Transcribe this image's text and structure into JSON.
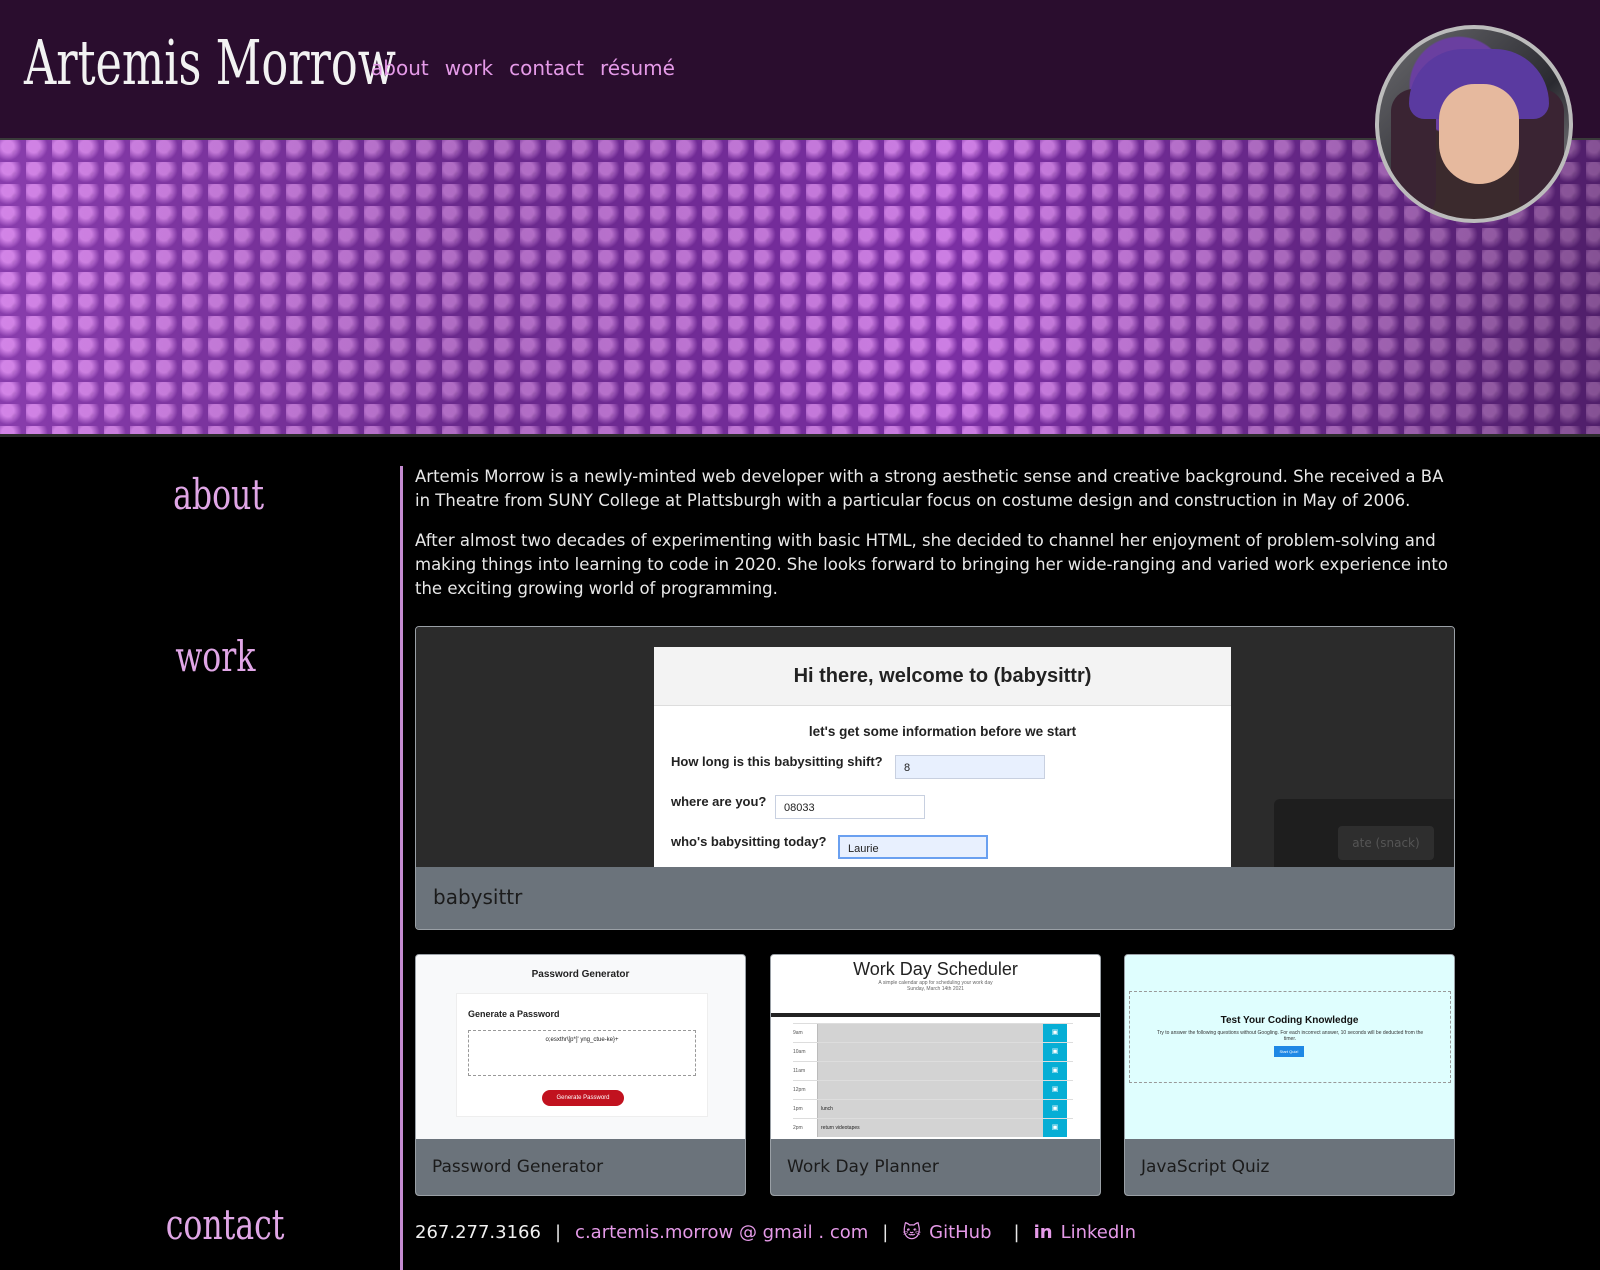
{
  "header": {
    "brand": "Artemis Morrow",
    "nav": [
      "about",
      "work",
      "contact",
      "résumé"
    ]
  },
  "sections": {
    "about_label": "about",
    "work_label": "work",
    "contact_label": "contact"
  },
  "about": {
    "p1": "Artemis Morrow is a newly-minted web developer with a strong aesthetic sense and creative background. She received a BA in Theatre from SUNY College at Plattsburgh with a particular focus on costume design and construction in May of 2006.",
    "p2": "After almost two decades of experimenting with basic HTML, she decided to channel her enjoyment of problem-solving and making things into learning to code in 2020. She looks forward to bringing her wide-ranging and varied work experience into the exciting growing world of programming."
  },
  "featured": {
    "title": "babysittr",
    "screenshot": {
      "heading": "Hi there, welcome to (babysittr)",
      "sub": "let's get some information before we start",
      "q1": "How long is this babysitting shift?",
      "a1": "8",
      "q2": "where are you?",
      "a2": "08033",
      "q3": "who's babysitting today?",
      "a3": "Laurie",
      "overlay_btn": "ate (snack)"
    }
  },
  "cards": [
    {
      "title": "Password Generator",
      "thumb": {
        "heading": "Password Generator",
        "sub": "Generate a Password",
        "output": "o;esxthr\\[p*]' yng_ctue-ke}+",
        "button": "Generate Password"
      }
    },
    {
      "title": "Work Day Planner",
      "thumb": {
        "heading": "Work Day Scheduler",
        "sub": "A simple calendar app for scheduling your work day",
        "date": "Sunday, March 14th 2021",
        "hours": [
          "9am",
          "10am",
          "11am",
          "12pm",
          "1pm",
          "2pm"
        ],
        "notes": [
          "",
          "",
          "",
          "",
          "lunch",
          "return videotapes"
        ]
      }
    },
    {
      "title": "JavaScript Quiz",
      "thumb": {
        "heading": "Test Your Coding Knowledge",
        "sub": "Try to answer the following questions without Googling. For each incorrect answer, 10 seconds will be deducted from the timer.",
        "button": "Start Quiz!"
      }
    }
  ],
  "contact": {
    "phone": "267.277.3166",
    "email": "c.artemis.morrow @ gmail . com",
    "github": "GitHub",
    "linkedin": "LinkedIn"
  },
  "colors": {
    "header_bg": "#2a0d2e",
    "accent": "#e59ae8",
    "card_footer": "#6b737b"
  }
}
